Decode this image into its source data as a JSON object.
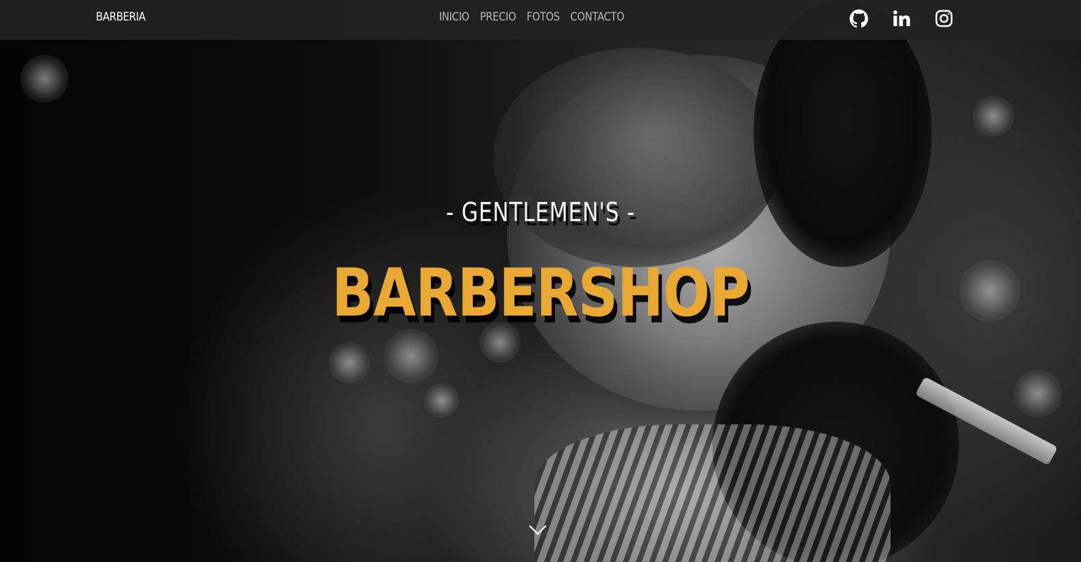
{
  "navbar": {
    "brand": "BARBERIA",
    "links": [
      {
        "label": "INICIO"
      },
      {
        "label": "PRECIO"
      },
      {
        "label": "FOTOS"
      },
      {
        "label": "CONTACTO"
      }
    ],
    "social": [
      {
        "icon": "github-icon"
      },
      {
        "icon": "linkedin-icon"
      },
      {
        "icon": "instagram-icon"
      }
    ]
  },
  "hero": {
    "subtitle": "- GENTLEMEN'S -",
    "title": "BARBERSHOP",
    "scroll_icon": "chevron-down-icon"
  },
  "colors": {
    "accent": "#e9a832",
    "navbar_bg": "#222222",
    "nav_link": "#b8b8b8"
  }
}
